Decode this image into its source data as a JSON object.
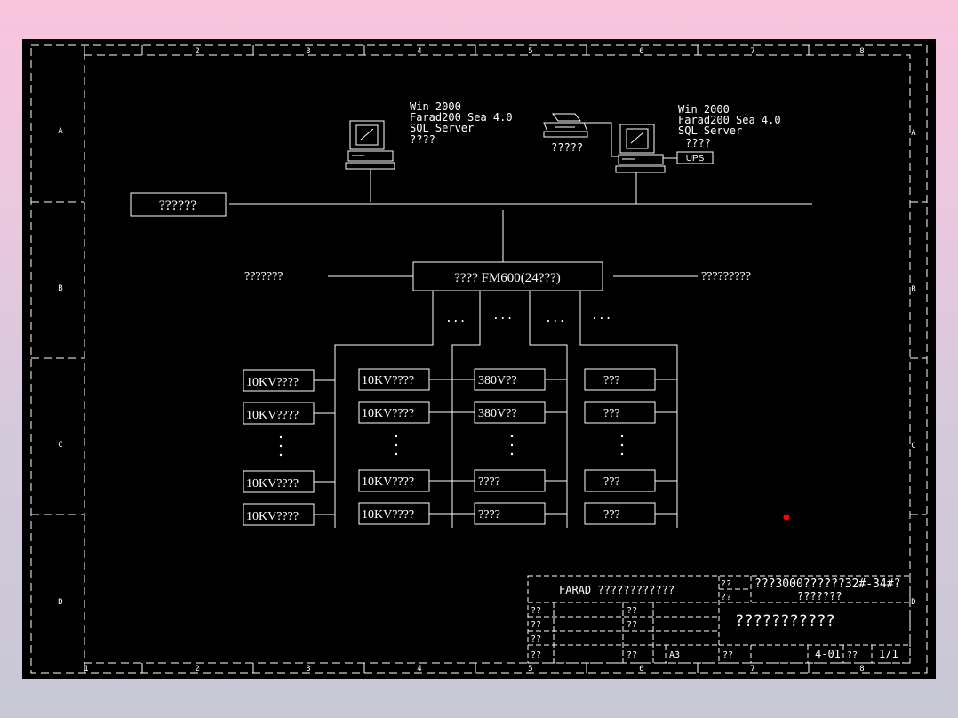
{
  "colors": {
    "background": "#000000",
    "line": "#ffffff",
    "marker": "#ff0000"
  },
  "border": {
    "columns_top": [
      "1",
      "2",
      "3",
      "4",
      "5",
      "6",
      "7",
      "8"
    ],
    "columns_bottom": [
      "1",
      "2",
      "3",
      "4",
      "5",
      "6",
      "7",
      "8"
    ],
    "rows": [
      "A",
      "B",
      "C",
      "D"
    ]
  },
  "stations": {
    "left": {
      "lines": [
        "Win 2000",
        "Farad200 Sea 4.0",
        "SQL Server",
        "????"
      ]
    },
    "right": {
      "lines": [
        "Win 2000",
        "Farad200 Sea 4.0",
        "SQL Server",
        "????"
      ],
      "ups": "UPS"
    },
    "printer_label": "?????"
  },
  "network_label": "??????",
  "device": {
    "label": "???? FM600(24???)",
    "left_label": "???????",
    "right_label": "?????????",
    "ellipses": [
      "...",
      "...",
      "...",
      "..."
    ]
  },
  "columns": [
    {
      "items": [
        "10KV????",
        "10KV????",
        "10KV????",
        "10KV????"
      ]
    },
    {
      "items": [
        "10KV????",
        "10KV????",
        "10KV????",
        "10KV????"
      ]
    },
    {
      "items": [
        "380V??",
        "380V??",
        "????",
        "????"
      ]
    },
    {
      "items": [
        "???",
        "???",
        "???",
        "???"
      ]
    }
  ],
  "title_block": {
    "company": "FARAD ????????????",
    "code": "??",
    "project": "???3000??????32#-34#?",
    "project2": "???????",
    "drawing_title": "???????????",
    "left_rows": [
      "??",
      "??",
      "??",
      "??"
    ],
    "mid_rows": [
      "??",
      "??",
      "??"
    ],
    "ratio": "A3",
    "sheet_code": "??",
    "drawing_no": "4-01",
    "pages_label": "??",
    "pages": "1/1"
  }
}
